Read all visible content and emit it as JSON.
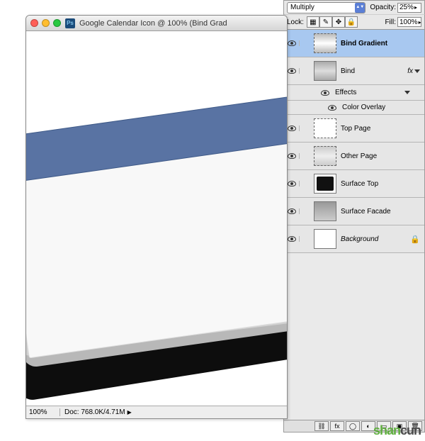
{
  "topbar": {
    "blend_mode": "Multiply",
    "opacity_label": "Opacity:",
    "opacity_value": "25%"
  },
  "lockbar": {
    "lock_label": "Lock:",
    "fill_label": "Fill:",
    "fill_value": "100%"
  },
  "layers": [
    {
      "name": "Bind Gradient",
      "selected": true,
      "bold": true,
      "thumb": "bind-grad"
    },
    {
      "name": "Bind",
      "thumb": "bind",
      "fx": true
    },
    {
      "sub": true,
      "label": "Effects"
    },
    {
      "subeffect": true,
      "label": "Color Overlay"
    },
    {
      "name": "Top Page",
      "thumb": "toppage"
    },
    {
      "name": "Other Page",
      "thumb": "otherpage"
    },
    {
      "name": "Surface Top",
      "thumb": "surftop"
    },
    {
      "name": "Surface Facade",
      "thumb": "surffa"
    },
    {
      "name": "Background",
      "thumb": "bg",
      "italic": true,
      "locked": true
    }
  ],
  "document": {
    "title": "Google Calendar Icon @ 100% (Bind Grad",
    "zoom": "100%",
    "doc_info": "Doc: 768.0K/4.71M"
  },
  "watermark": {
    "a": "shan",
    "b": "cun"
  }
}
